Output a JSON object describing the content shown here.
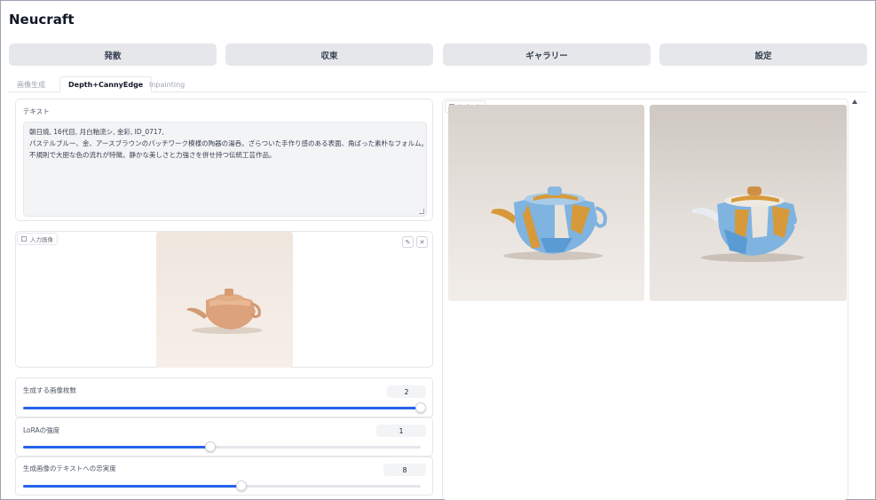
{
  "app": {
    "title": "Neucraft"
  },
  "nav": {
    "buttons": [
      "発散",
      "収束",
      "ギャラリー",
      "設定"
    ]
  },
  "tabs": {
    "items": [
      "画像生成",
      "Depth+CannyEdge",
      "Inpainting"
    ],
    "active": 1
  },
  "prompt": {
    "label": "テキスト",
    "lines": [
      "朝日焼, 16代目, 月白釉流シ, 金彩, ID_0717,",
      "パステルブルー、金、アースブラウンのパッチワーク模様の陶器の湯呑。ざらついた手作り感のある表面、角ばった素朴なフォルム。",
      "不規則で大胆な色の流れが特徴。静かな美しさと力強さを併せ持つ伝統工芸作品。"
    ]
  },
  "input_image": {
    "label": "入力画像",
    "edit_icon": "pencil-icon",
    "clear_icon": "close-icon"
  },
  "output": {
    "label": "生成画像",
    "image_count": 2
  },
  "sliders": [
    {
      "label": "生成する画像枚数",
      "value": "2",
      "fraction": 1.0
    },
    {
      "label": "LoRAの強度",
      "value": "1",
      "fraction": 0.47
    },
    {
      "label": "生成画像のテキストへの忠実度",
      "value": "8",
      "fraction": 0.55
    }
  ],
  "colors": {
    "accent": "#2563eb",
    "button_bg": "#e5e7eb",
    "field_bg": "#f3f4f6",
    "teapot_blue": "#7fb3e0",
    "teapot_gold": "#d79a3a",
    "clay": "#d9a27e"
  }
}
